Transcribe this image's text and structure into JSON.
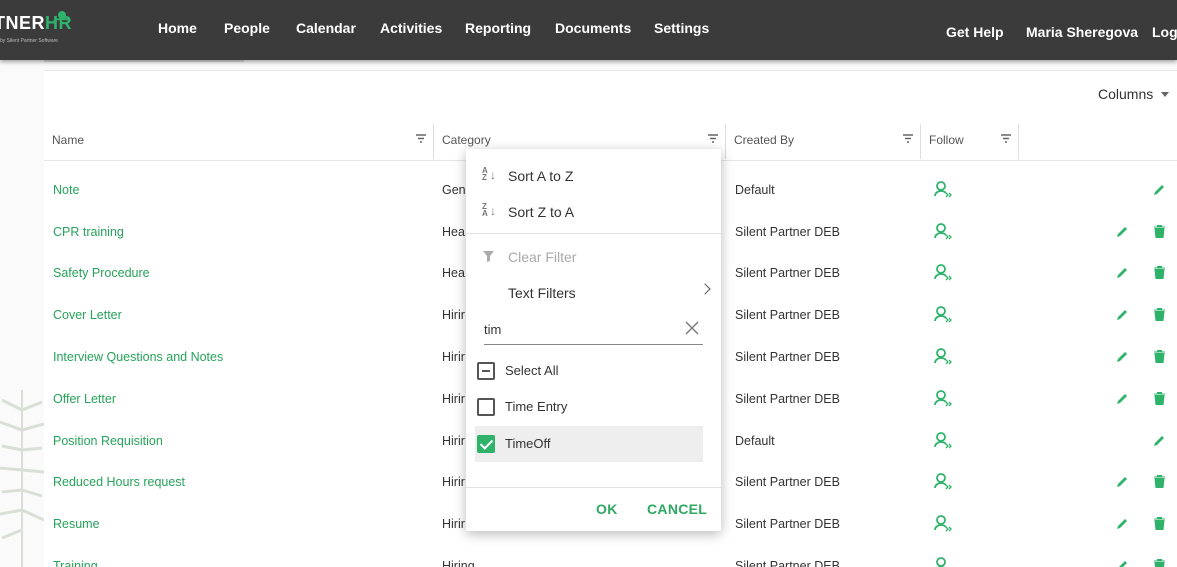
{
  "logo": {
    "text_main": "TNER",
    "text_hr": "HR",
    "tagline": "by Silent Partner Software"
  },
  "nav": {
    "items": [
      "Home",
      "People",
      "Calendar",
      "Activities",
      "Reporting",
      "Documents",
      "Settings"
    ],
    "right": [
      "Get Help",
      "Maria Sheregova",
      "Log"
    ]
  },
  "toolbar": {
    "columns_label": "Columns"
  },
  "grid": {
    "headers": [
      "Name",
      "Category",
      "Created By",
      "Follow"
    ],
    "rows": [
      {
        "name": "Note",
        "category": "Gen",
        "created_by": "Default",
        "can_delete": false
      },
      {
        "name": "CPR training",
        "category": "Hea",
        "created_by": "Silent Partner DEB",
        "can_delete": true
      },
      {
        "name": "Safety Procedure",
        "category": "Hea",
        "created_by": "Silent Partner DEB",
        "can_delete": true
      },
      {
        "name": "Cover Letter",
        "category": "Hirir",
        "created_by": "Silent Partner DEB",
        "can_delete": true
      },
      {
        "name": "Interview Questions and Notes",
        "category": "Hirir",
        "created_by": "Silent Partner DEB",
        "can_delete": true
      },
      {
        "name": "Offer Letter",
        "category": "Hirir",
        "created_by": "Silent Partner DEB",
        "can_delete": true
      },
      {
        "name": "Position Requisition",
        "category": "Hirir",
        "created_by": "Default",
        "can_delete": false
      },
      {
        "name": "Reduced Hours request",
        "category": "Hirir",
        "created_by": "Silent Partner DEB",
        "can_delete": true
      },
      {
        "name": "Resume",
        "category": "Hirir",
        "created_by": "Silent Partner DEB",
        "can_delete": true
      },
      {
        "name": "Training",
        "category": "Hiring",
        "created_by": "Silent Partner DEB",
        "can_delete": true
      }
    ]
  },
  "filter_popup": {
    "sort_asc": "Sort A to Z",
    "sort_desc": "Sort Z to A",
    "clear_filter": "Clear Filter",
    "text_filters": "Text Filters",
    "search_value": "tim",
    "options": [
      {
        "label": "Select All",
        "state": "indeterminate"
      },
      {
        "label": "Time Entry",
        "state": "unchecked"
      },
      {
        "label": "TimeOff",
        "state": "checked"
      }
    ],
    "ok": "OK",
    "cancel": "CANCEL"
  },
  "colors": {
    "accent": "#2fb36b",
    "link": "#27a35a",
    "topbar": "#3b3b3b"
  }
}
